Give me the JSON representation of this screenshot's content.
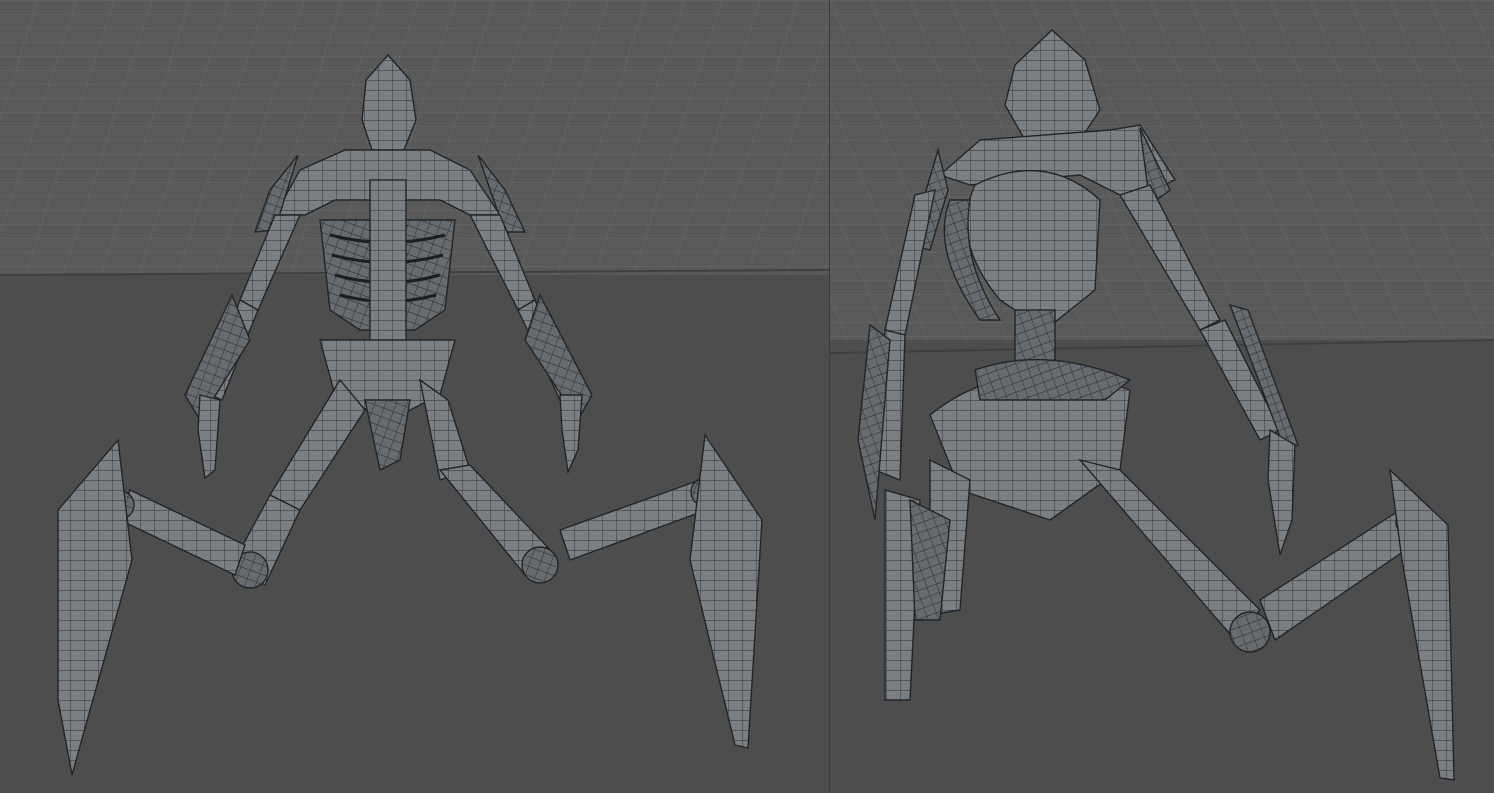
{
  "app": {
    "layout": "split-viewport",
    "colors": {
      "background": "#4d4d4d",
      "floor": "#555555",
      "grid_line": "#6b6b6b",
      "mesh_fill": "#7c8186",
      "mesh_fill_dark": "#5f6469",
      "wire": "#2a2d30",
      "highlight": "#b7bcc1"
    }
  },
  "viewports": [
    {
      "id": "left",
      "view": "front",
      "subject": "armored-skeletal-creature-wireframe",
      "grid": true
    },
    {
      "id": "right",
      "view": "rear-three-quarter",
      "subject": "armored-skeletal-creature-wireframe",
      "grid": true
    }
  ]
}
